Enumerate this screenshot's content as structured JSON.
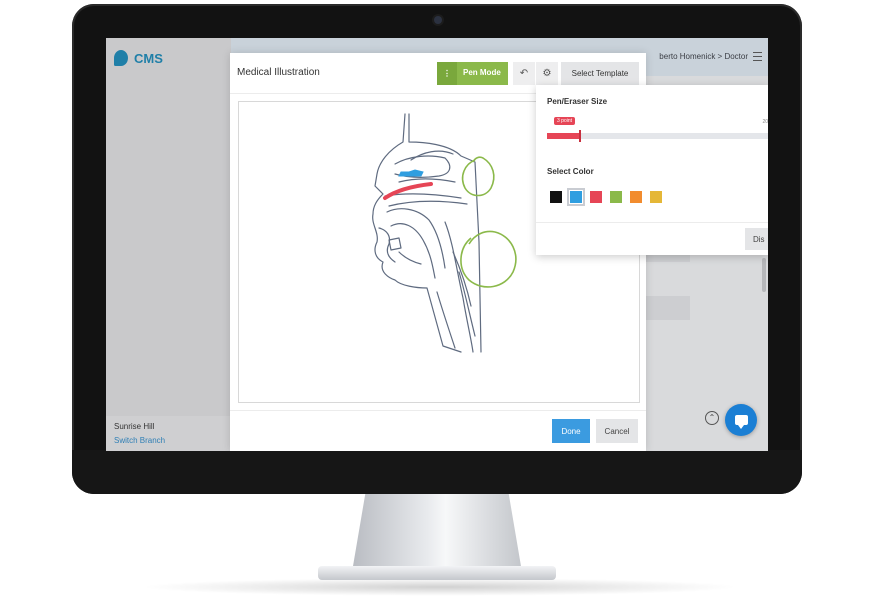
{
  "app": {
    "brand": "CMS",
    "user": "berto Homenick > Doctor",
    "branch_name": "Sunrise Hill",
    "switch_branch": "Switch Branch",
    "scroll_top_glyph": "⌃"
  },
  "modal": {
    "title": "Medical Illustration",
    "pen_mode_label": "Pen Mode",
    "pen_grip_glyph": "⋮",
    "undo_glyph": "↶",
    "settings_glyph": "⚙",
    "select_template_label": "Select Template",
    "done_label": "Done",
    "cancel_label": "Cancel"
  },
  "pen_settings": {
    "size_title": "Pen/Eraser Size",
    "size_value_label": "3 point",
    "size_max_label": "20",
    "size_value": 3,
    "size_max": 20,
    "color_title": "Select Color",
    "colors": [
      "#111111",
      "#2f9ee0",
      "#e64556",
      "#8bb94a",
      "#f28c2e",
      "#e5b737"
    ],
    "selected_color_index": 1,
    "discard_label": "Dis"
  },
  "icons": {
    "logo": "cms-logo-icon",
    "menu": "hamburger-menu-icon",
    "chat": "chat-bubble-icon"
  }
}
